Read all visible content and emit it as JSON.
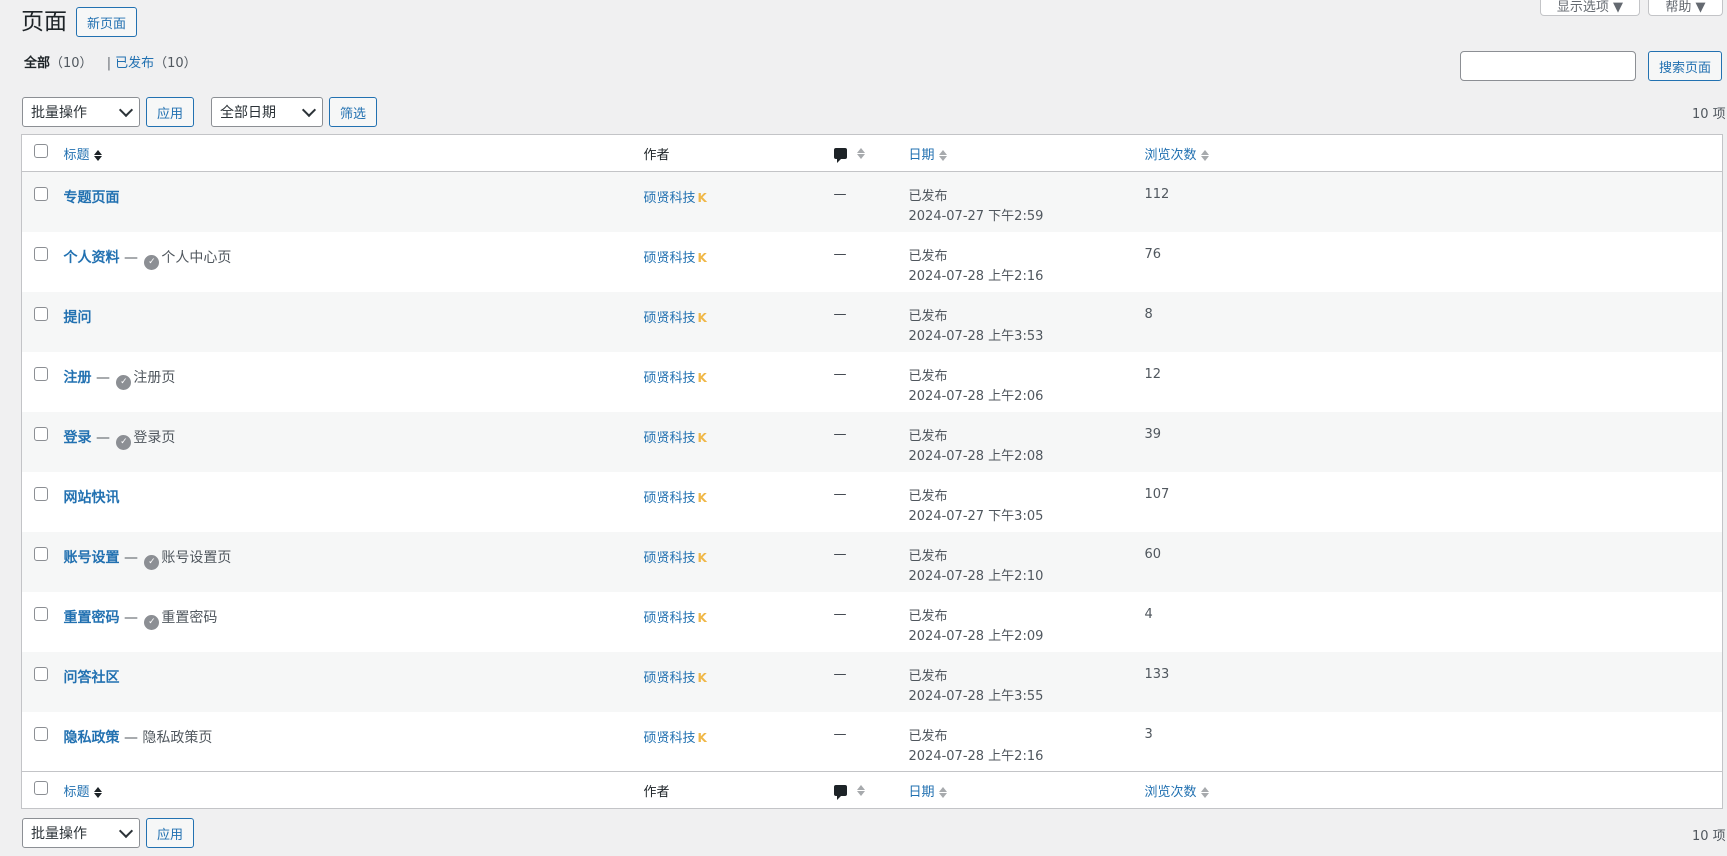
{
  "page": {
    "title": "页面",
    "add_new_label": "新页面",
    "screen_options_label": "显示选项 ▼",
    "help_label": "帮助 ▼"
  },
  "views": {
    "all_label": "全部",
    "all_count": "（10）",
    "separator": "|",
    "published_label": "已发布",
    "published_count": "（10）"
  },
  "search": {
    "placeholder": "",
    "button_label": "搜索页面"
  },
  "filters": {
    "bulk_actions_label": "批量操作",
    "apply_label": "应用",
    "dates_label": "全部日期",
    "filter_label": "筛选",
    "items_count": "10 项"
  },
  "table": {
    "columns": {
      "title": "标题",
      "author": "作者",
      "date": "日期",
      "views": "浏览次数"
    },
    "rows": [
      {
        "title": "专题页面",
        "state": "",
        "author": "硕贤科技",
        "author_badge": "K",
        "comments": "—",
        "status": "已发布",
        "date": "2024-07-27 下午2:59",
        "views": "112"
      },
      {
        "title": "个人资料",
        "state": "个人中心页",
        "author": "硕贤科技",
        "author_badge": "K",
        "comments": "—",
        "status": "已发布",
        "date": "2024-07-28 上午2:16",
        "views": "76"
      },
      {
        "title": "提问",
        "state": "",
        "author": "硕贤科技",
        "author_badge": "K",
        "comments": "—",
        "status": "已发布",
        "date": "2024-07-28 上午3:53",
        "views": "8"
      },
      {
        "title": "注册",
        "state": "注册页",
        "author": "硕贤科技",
        "author_badge": "K",
        "comments": "—",
        "status": "已发布",
        "date": "2024-07-28 上午2:06",
        "views": "12"
      },
      {
        "title": "登录",
        "state": "登录页",
        "author": "硕贤科技",
        "author_badge": "K",
        "comments": "—",
        "status": "已发布",
        "date": "2024-07-28 上午2:08",
        "views": "39"
      },
      {
        "title": "网站快讯",
        "state": "",
        "author": "硕贤科技",
        "author_badge": "K",
        "comments": "—",
        "status": "已发布",
        "date": "2024-07-27 下午3:05",
        "views": "107"
      },
      {
        "title": "账号设置",
        "state": "账号设置页",
        "author": "硕贤科技",
        "author_badge": "K",
        "comments": "—",
        "status": "已发布",
        "date": "2024-07-28 上午2:10",
        "views": "60"
      },
      {
        "title": "重置密码",
        "state": "重置密码",
        "author": "硕贤科技",
        "author_badge": "K",
        "comments": "—",
        "status": "已发布",
        "date": "2024-07-28 上午2:09",
        "views": "4"
      },
      {
        "title": "问答社区",
        "state": "",
        "author": "硕贤科技",
        "author_badge": "K",
        "comments": "—",
        "status": "已发布",
        "date": "2024-07-28 上午3:55",
        "views": "133"
      },
      {
        "title": "隐私政策",
        "state": "隐私政策页",
        "author": "硕贤科技",
        "author_badge": "K",
        "comments": "—",
        "status": "已发布",
        "date": "2024-07-28 上午2:16",
        "views": "3"
      }
    ]
  },
  "bottom": {
    "bulk_actions_label": "批量操作",
    "apply_label": "应用",
    "items_count": "10 项"
  },
  "colors": {
    "link": "#2271b1",
    "background": "#f0f0f1",
    "badge": "#f0b849"
  }
}
